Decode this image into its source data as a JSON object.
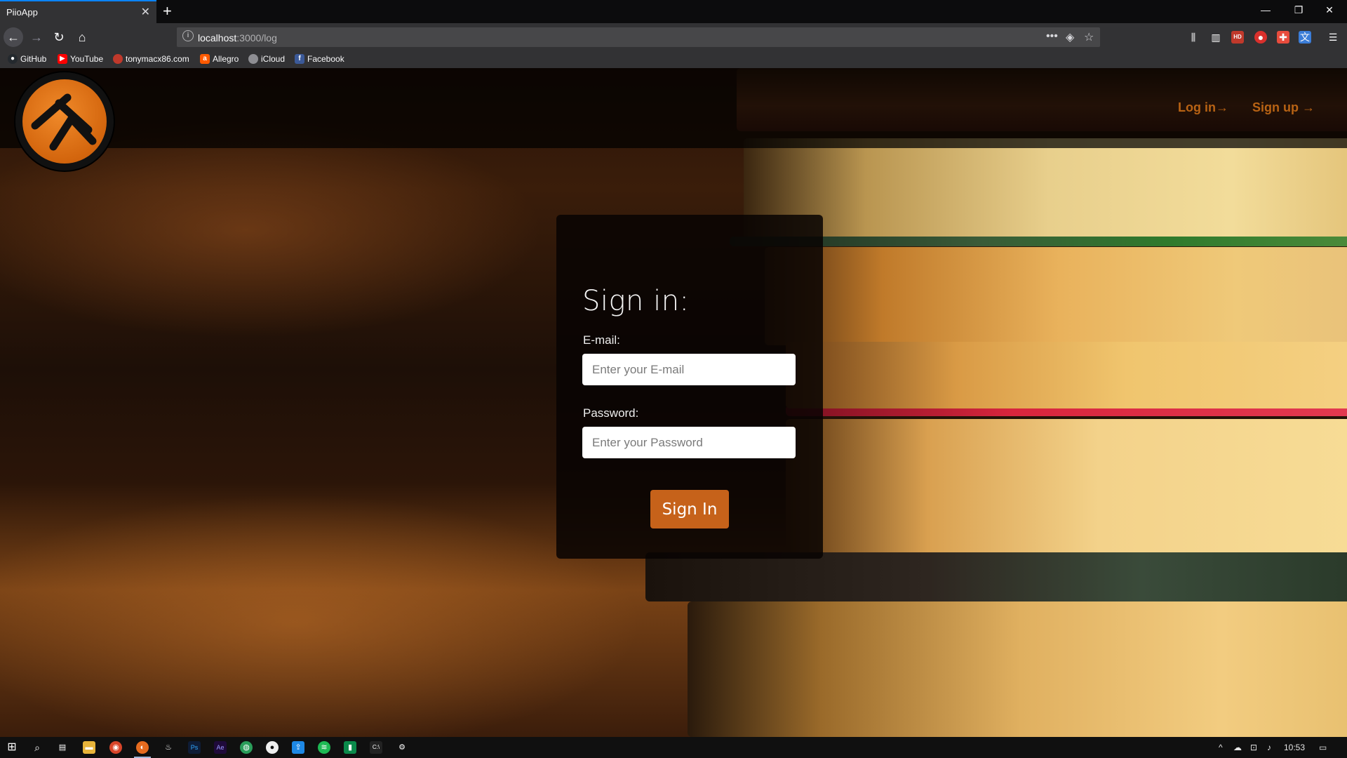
{
  "browser": {
    "tab_title": "PiioApp",
    "url_host": "localhost",
    "url_path": ":3000/log",
    "bookmarks": [
      {
        "label": "GitHub",
        "icon": "github-icon",
        "color": "#24292e"
      },
      {
        "label": "YouTube",
        "icon": "youtube-icon",
        "color": "#ff0000"
      },
      {
        "label": "tonymacx86.com",
        "icon": "apple-icon",
        "color": "#c0392b"
      },
      {
        "label": "Allegro",
        "icon": "allegro-icon",
        "color": "#ff5a00"
      },
      {
        "label": "iCloud",
        "icon": "apple-icon",
        "color": "#8e8e93"
      },
      {
        "label": "Facebook",
        "icon": "facebook-icon",
        "color": "#3b5998"
      }
    ]
  },
  "page": {
    "nav": {
      "login": "Log in→",
      "signup": "Sign up →"
    },
    "form": {
      "title": "Sign in:",
      "email_label": "E-mail:",
      "email_placeholder": "Enter your E-mail",
      "password_label": "Password:",
      "password_placeholder": "Enter your Password",
      "submit": "Sign In"
    }
  },
  "taskbar": {
    "clock": "10:53"
  },
  "colors": {
    "accent": "#c6621a",
    "nav_link": "#b86314",
    "logo": "#e0761a"
  }
}
